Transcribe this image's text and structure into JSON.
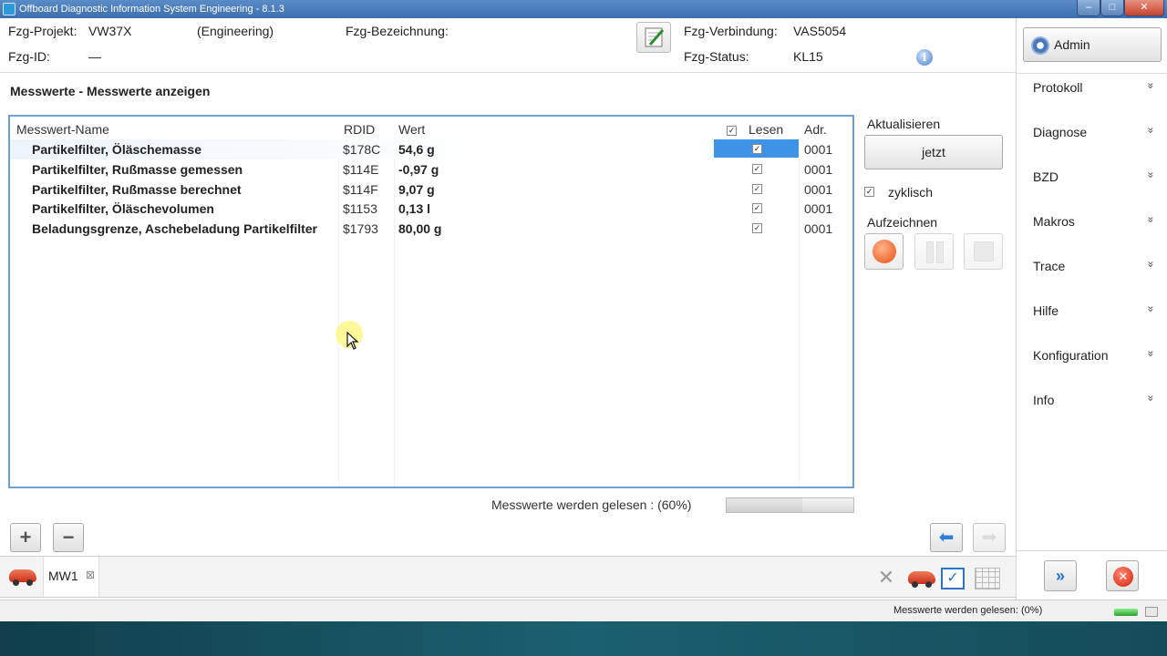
{
  "window": {
    "title": "Offboard Diagnostic Information System Engineering - 8.1.3"
  },
  "header": {
    "projekt_label": "Fzg-Projekt:",
    "projekt_value": "VW37X",
    "projekt_mode": "(Engineering)",
    "bezeichnung_label": "Fzg-Bezeichnung:",
    "id_label": "Fzg-ID:",
    "id_value": "—",
    "verbindung_label": "Fzg-Verbindung:",
    "verbindung_value": "VAS5054",
    "status_label": "Fzg-Status:",
    "status_value": "KL15"
  },
  "page": {
    "title": "Messwerte - Messwerte anzeigen"
  },
  "table": {
    "columns": {
      "name": "Messwert-Name",
      "rdid": "RDID",
      "wert": "Wert",
      "lesen": "Lesen",
      "adr": "Adr."
    },
    "rows": [
      {
        "name": "Partikelfilter, Öläschemasse",
        "rdid": "$178C",
        "wert": "54,6 g",
        "adr": "0001",
        "lesen": true
      },
      {
        "name": "Partikelfilter, Rußmasse gemessen",
        "rdid": "$114E",
        "wert": "-0,97 g",
        "adr": "0001",
        "lesen": true
      },
      {
        "name": "Partikelfilter, Rußmasse berechnet",
        "rdid": "$114F",
        "wert": "9,07 g",
        "adr": "0001",
        "lesen": true
      },
      {
        "name": "Partikelfilter, Öläschevolumen",
        "rdid": "$1153",
        "wert": "0,13 l",
        "adr": "0001",
        "lesen": true
      },
      {
        "name": "Beladungsgrenze, Aschebeladung Partikelfilter",
        "rdid": "$1793",
        "wert": "80,00 g",
        "adr": "0001",
        "lesen": true
      }
    ]
  },
  "controls": {
    "aktualisieren_label": "Aktualisieren",
    "jetzt_label": "jetzt",
    "zyklisch_label": "zyklisch",
    "aufzeichnen_label": "Aufzeichnen"
  },
  "progress": {
    "text": "Messwerte werden gelesen : (60%)",
    "percent": 60
  },
  "tabs": {
    "mw1_label": "MW1",
    "close_glyph": "⊠"
  },
  "sidebar": {
    "admin_label": "Admin",
    "items": [
      {
        "label": "Protokoll"
      },
      {
        "label": "Diagnose"
      },
      {
        "label": "BZD"
      },
      {
        "label": "Makros"
      },
      {
        "label": "Trace"
      },
      {
        "label": "Hilfe"
      },
      {
        "label": "Konfiguration"
      },
      {
        "label": "Info"
      }
    ],
    "chevron": "»"
  },
  "statusbar": {
    "text": "Messwerte werden gelesen: (0%)"
  },
  "icons": {
    "plus": "+",
    "minus": "−",
    "back": "⬅",
    "forward": "➡",
    "next": "»",
    "exit": "✕",
    "check": "✓",
    "info": "i",
    "x": "✕"
  }
}
